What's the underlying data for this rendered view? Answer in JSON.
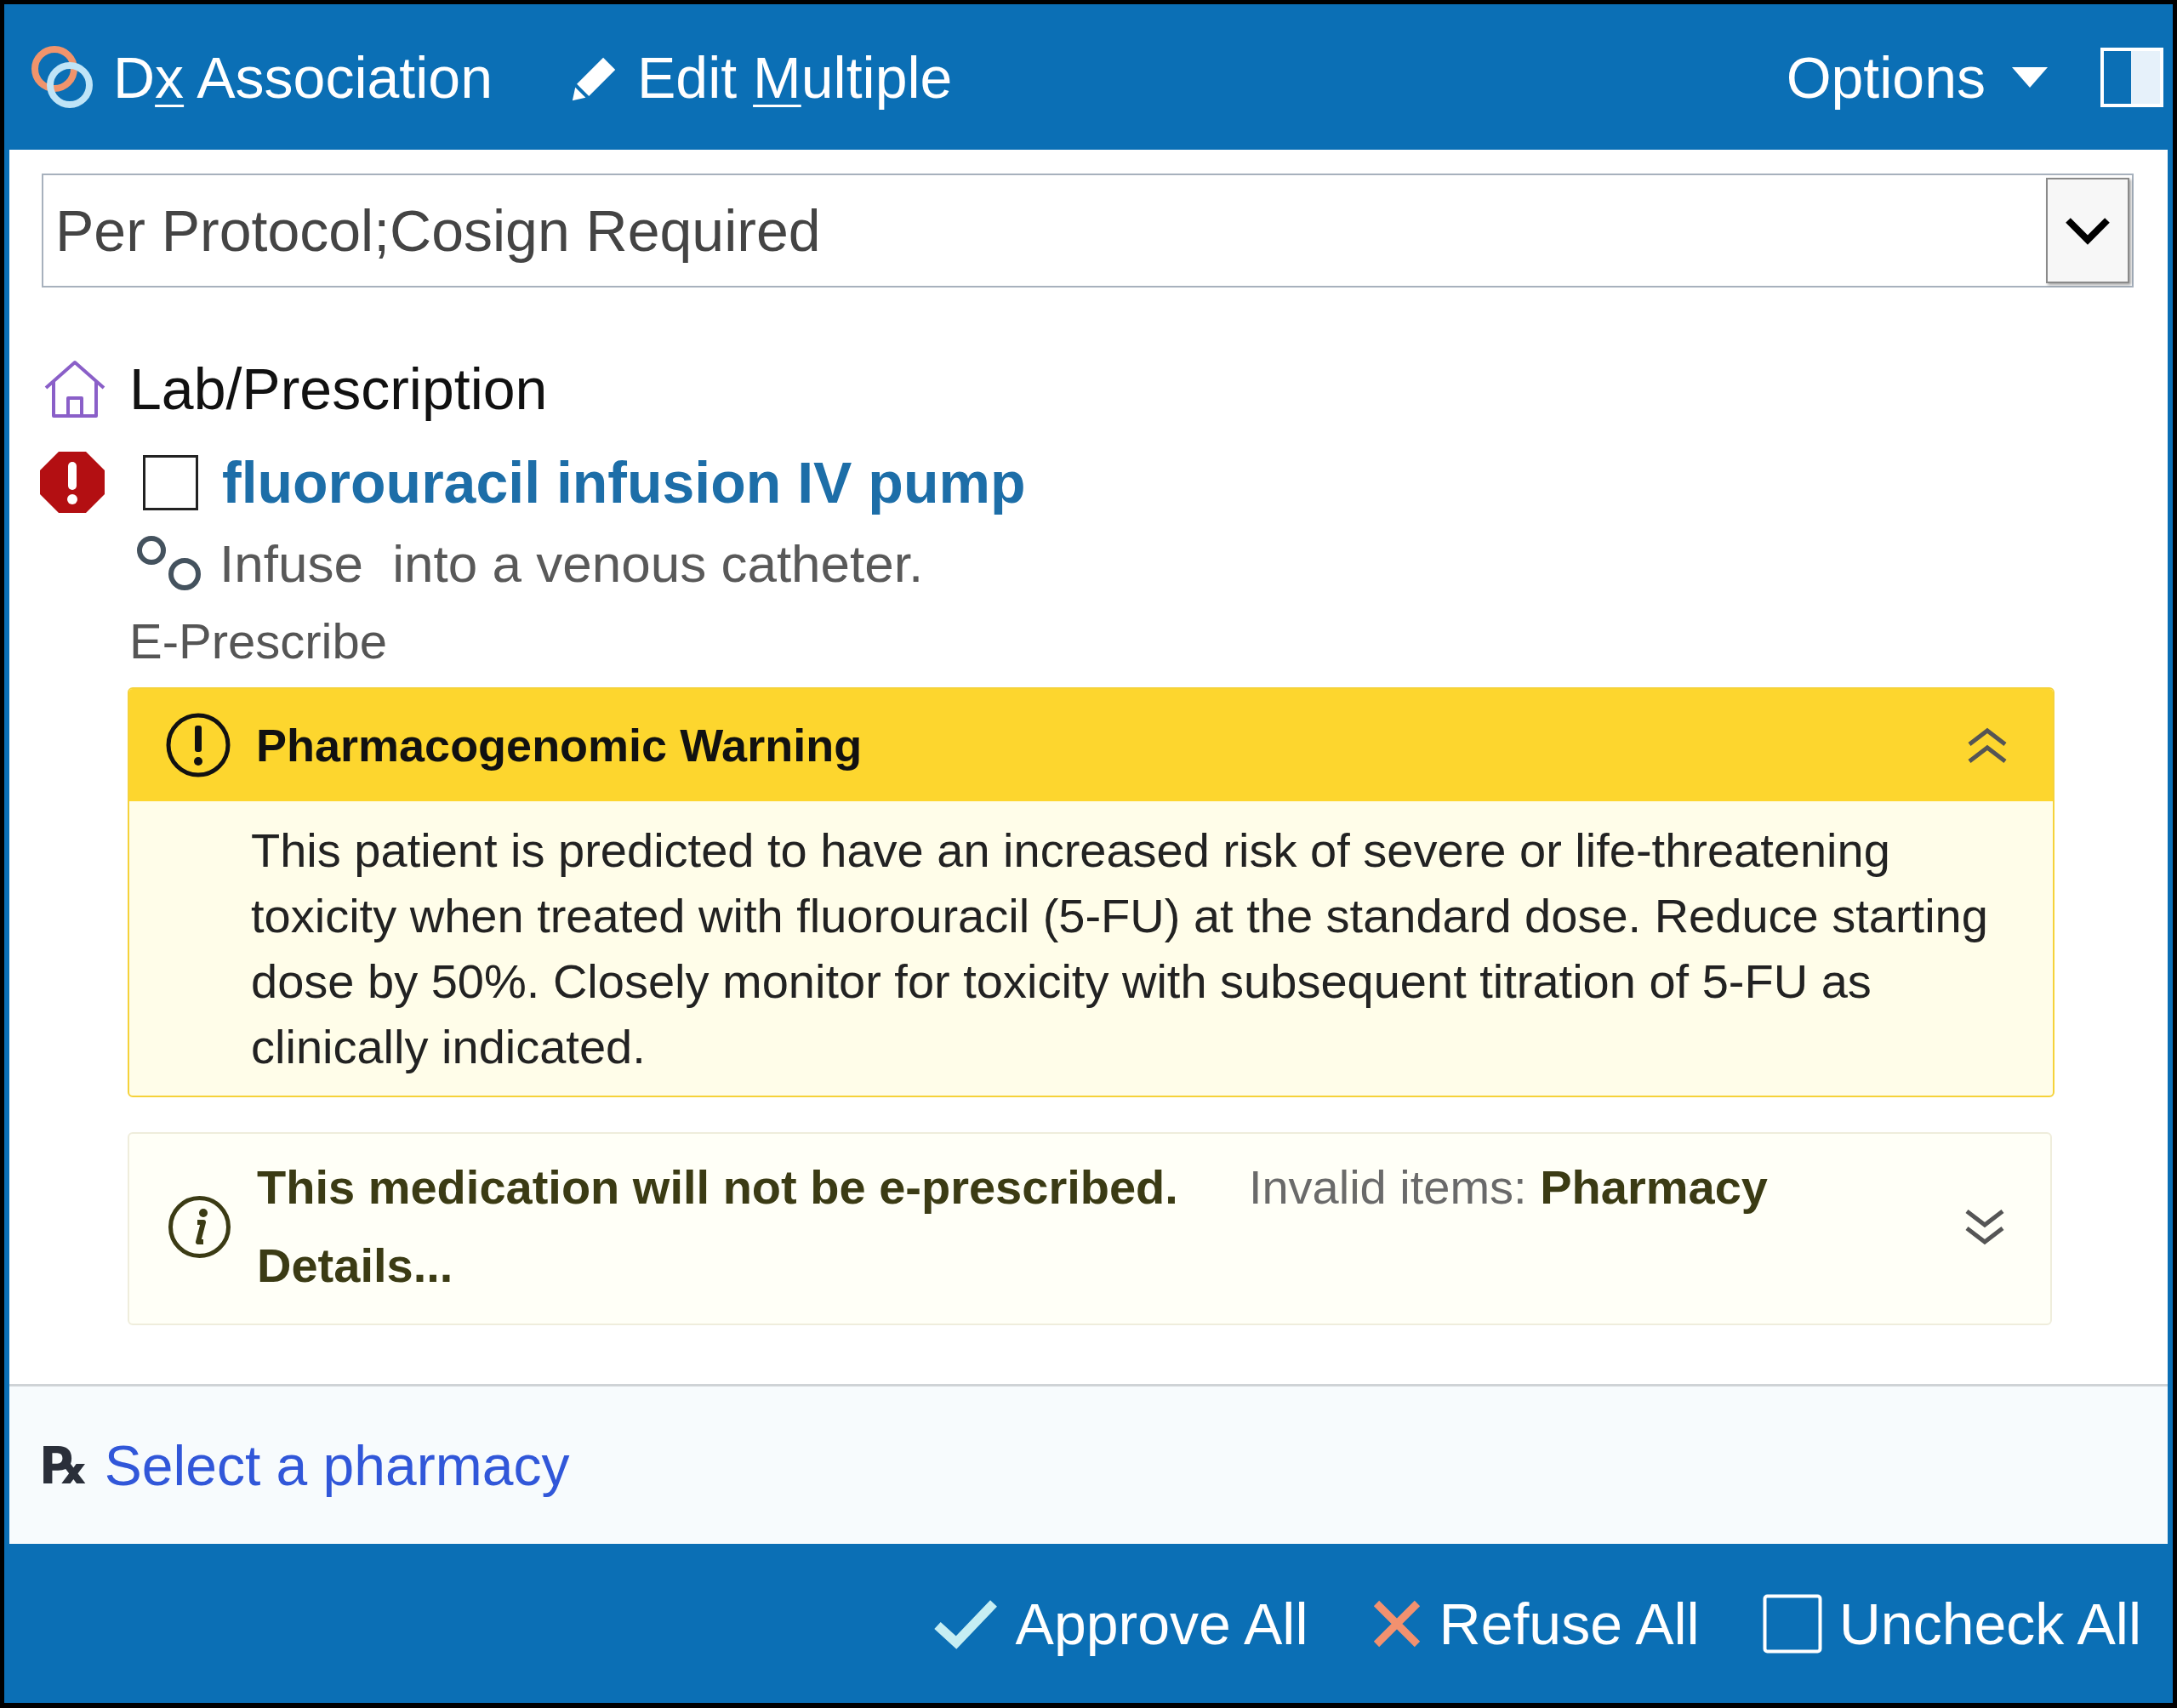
{
  "toolbar": {
    "buttons": [
      {
        "kind": "dx",
        "label_parts": [
          {
            "text": "D",
            "underlined": false
          },
          {
            "text": "x",
            "underlined": true
          },
          {
            "text": " Association",
            "underlined": false
          }
        ]
      },
      {
        "kind": "edit",
        "label_parts": [
          {
            "text": "Edit ",
            "underlined": false
          },
          {
            "text": "M",
            "underlined": true
          },
          {
            "text": "ultiple",
            "underlined": false
          }
        ]
      }
    ],
    "options": {
      "label": "Options"
    }
  },
  "order_sentence": {
    "value": "Per Protocol;Cosign Required"
  },
  "section": {
    "title": "Lab/Prescription"
  },
  "order": {
    "name": "fluorouracil infusion IV pump",
    "checked": false,
    "details": "Infuse  into a venous catheter.",
    "type": "E-Prescribe"
  },
  "alerts": [
    {
      "kind": "warning",
      "title": "Pharmacogenomic Warning",
      "expanded": true,
      "body": "This patient is predicted to have an increased risk of severe or life-threatening toxicity when treated with fluorouracil (5-FU) at the standard dose. Reduce starting dose by 50%. Closely monitor for toxicity with subsequent titration of 5-FU as clinically indicated."
    },
    {
      "kind": "info",
      "expanded": false,
      "message": "This medication will not be e-prescribed.",
      "invalid_items": "Invalid items: **Pharmacy**",
      "link": "Details..."
    }
  ],
  "pharmacy": {
    "icon": "℞",
    "label": "Select a pharmacy"
  },
  "footer": {
    "buttons": [
      {
        "kind": "approve",
        "label": "Approve All"
      },
      {
        "kind": "refuse",
        "label": "Refuse All"
      },
      {
        "kind": "uncheck",
        "label": "Uncheck All"
      }
    ]
  }
}
